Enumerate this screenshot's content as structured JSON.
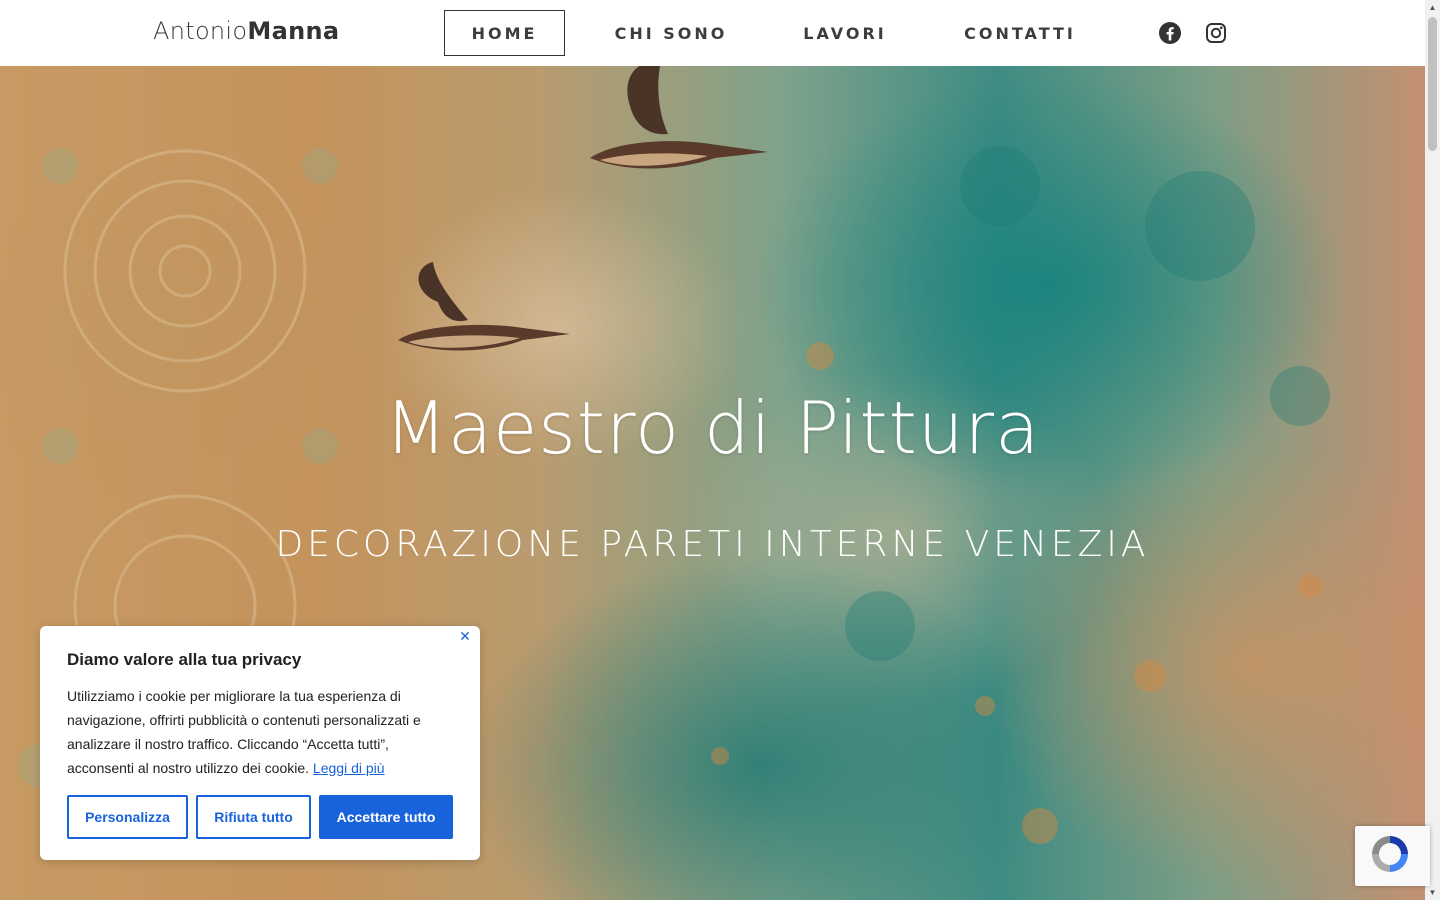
{
  "header": {
    "logo_first": "Antonio",
    "logo_second": "Manna",
    "nav": [
      {
        "label": "HOME",
        "active": true
      },
      {
        "label": "CHI SONO",
        "active": false
      },
      {
        "label": "LAVORI",
        "active": false
      },
      {
        "label": "CONTATTI",
        "active": false
      }
    ],
    "social": [
      {
        "icon": "facebook-icon"
      },
      {
        "icon": "instagram-icon"
      }
    ]
  },
  "hero": {
    "title": "Maestro di Pittura",
    "subtitle": "DECORAZIONE PARETI INTERNE VENEZIA"
  },
  "cookie": {
    "title": "Diamo valore alla tua privacy",
    "text": "Utilizziamo i cookie per migliorare la tua esperienza di navigazione, offrirti pubblicità o contenuti personalizzati e analizzare il nostro traffico. Cliccando “Accetta tutti”, acconsenti al nostro utilizzo dei cookie.",
    "link": "Leggi di più",
    "close_icon": "close-icon",
    "buttons": {
      "customize": "Personalizza",
      "reject": "Rifiuta tutto",
      "accept": "Accettare tutto"
    }
  },
  "colors": {
    "accent": "#1863dc",
    "text_dark": "#333333",
    "header_bg": "#ffffff"
  }
}
